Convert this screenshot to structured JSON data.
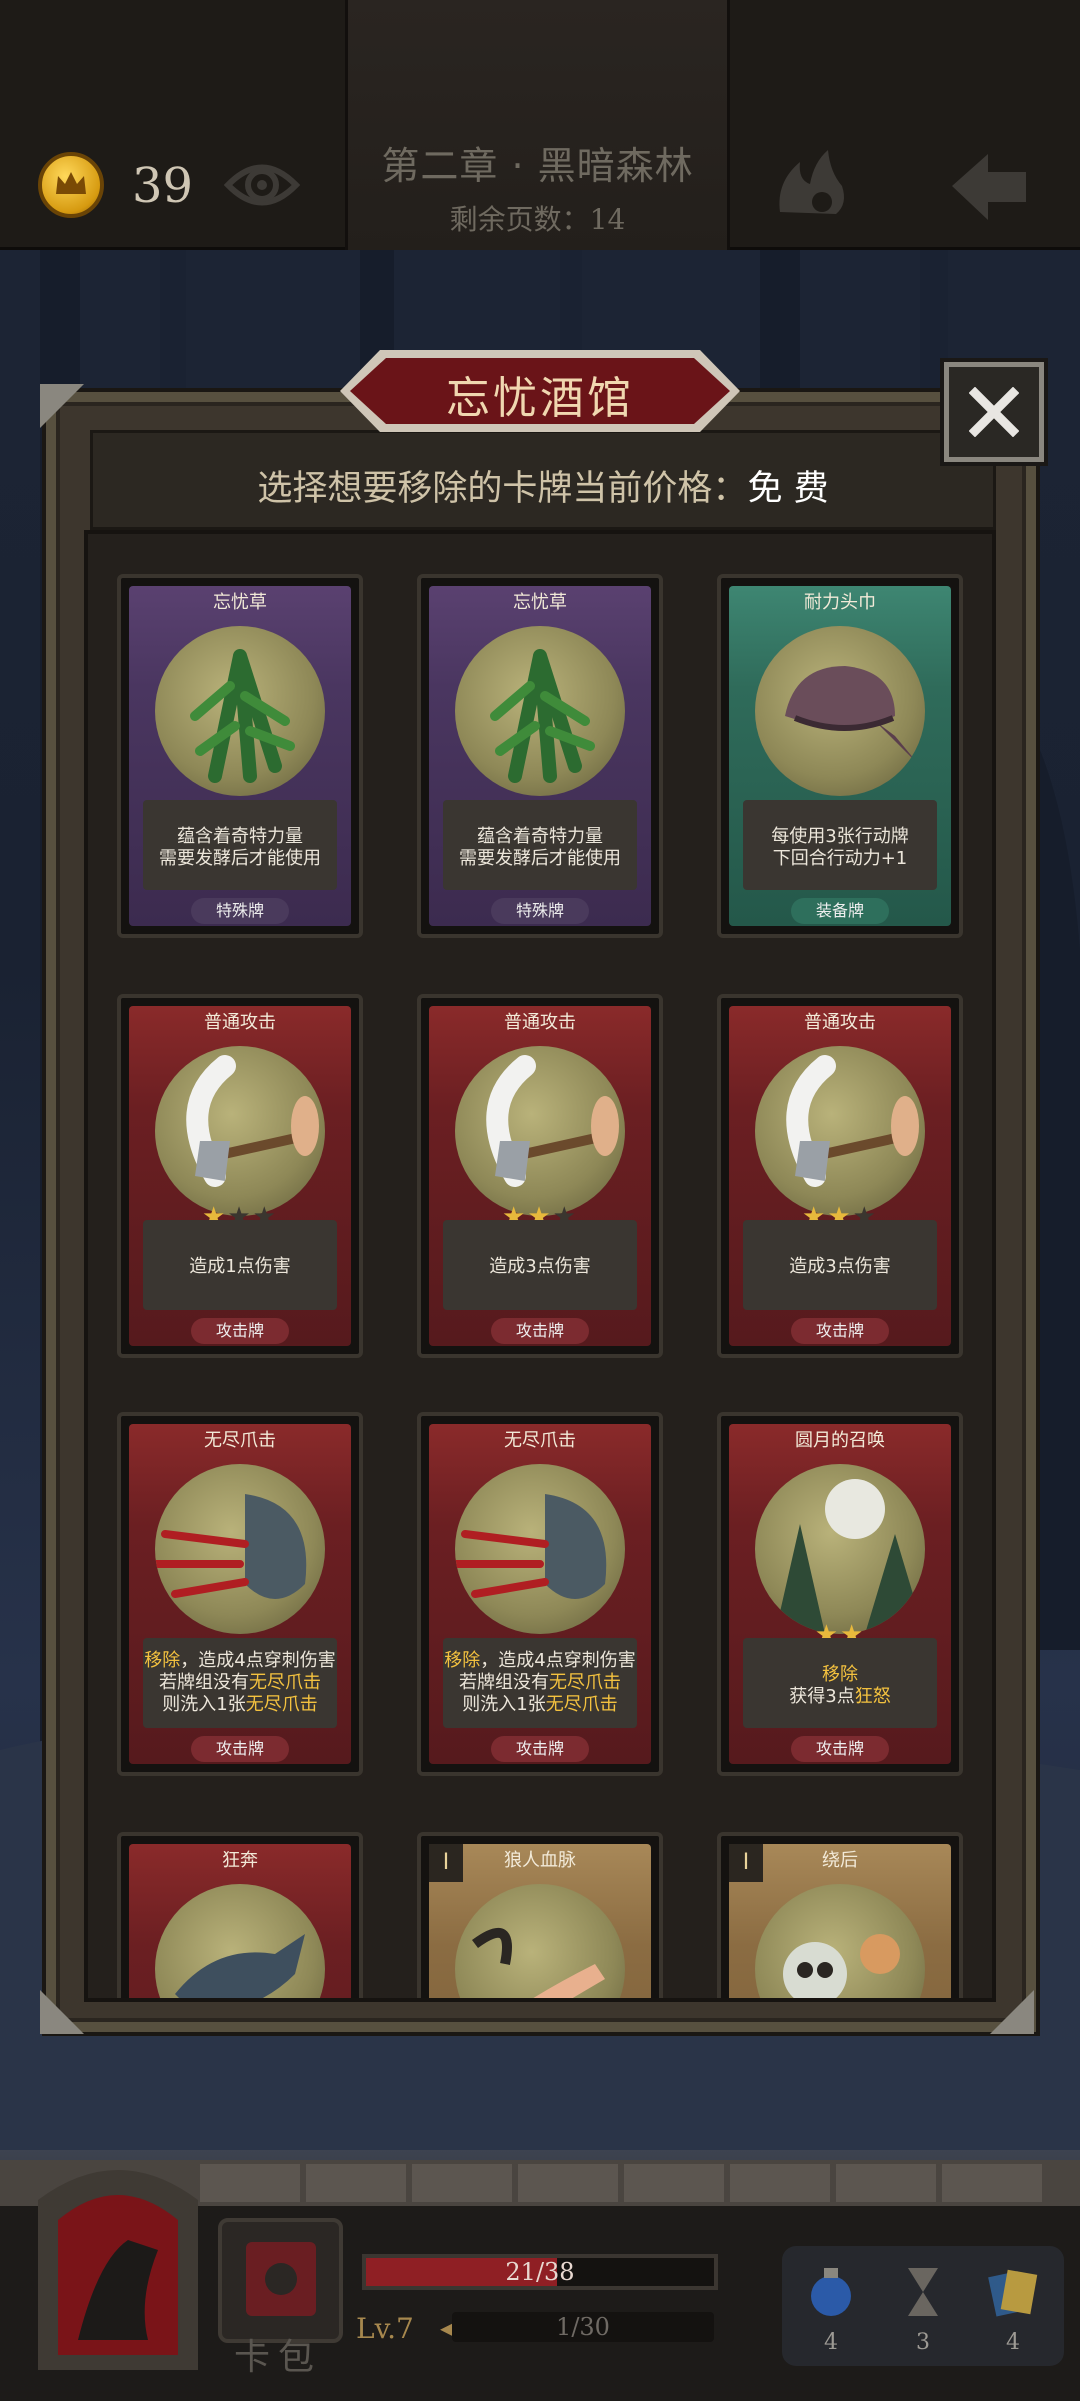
{
  "header": {
    "coins": "39",
    "chapter_title": "第二章 · 黑暗森林",
    "pages_label": "剩余页数：",
    "pages_value": "14"
  },
  "panel": {
    "title": "忘忧酒馆",
    "subtitle_prefix": "选择想要移除的卡牌当前价格：",
    "price": "免 费"
  },
  "cards": [
    {
      "name": "忘忧草",
      "desc": [
        "蕴含着奇特力量",
        "需要发酵后才能使用"
      ],
      "type": "特殊牌",
      "color": "purple"
    },
    {
      "name": "忘忧草",
      "desc": [
        "蕴含着奇特力量",
        "需要发酵后才能使用"
      ],
      "type": "特殊牌",
      "color": "purple"
    },
    {
      "name": "耐力头巾",
      "desc": [
        "每使用3张行动牌",
        "下回合行动力+1"
      ],
      "type": "装备牌",
      "color": "teal"
    },
    {
      "name": "普通攻击",
      "stars": 1,
      "desc": [
        "造成1点伤害"
      ],
      "type": "攻击牌",
      "color": "red"
    },
    {
      "name": "普通攻击",
      "stars": 2,
      "desc": [
        "造成3点伤害"
      ],
      "type": "攻击牌",
      "color": "red"
    },
    {
      "name": "普通攻击",
      "stars": 2,
      "desc": [
        "造成3点伤害"
      ],
      "type": "攻击牌",
      "color": "red"
    },
    {
      "name": "无尽爪击",
      "desc": [
        "移除，造成4点穿刺伤害",
        "若牌组没有无尽爪击",
        "则洗入1张无尽爪击"
      ],
      "type": "攻击牌",
      "color": "red"
    },
    {
      "name": "无尽爪击",
      "desc": [
        "移除，造成4点穿刺伤害",
        "若牌组没有无尽爪击",
        "则洗入1张无尽爪击"
      ],
      "type": "攻击牌",
      "color": "red"
    },
    {
      "name": "圆月的召唤",
      "stars": 2,
      "desc": [
        "移除",
        "获得3点狂怒"
      ],
      "type": "攻击牌",
      "color": "red"
    },
    {
      "name": "狂奔",
      "color": "red"
    },
    {
      "name": "狼人血脉",
      "color": "tan",
      "tag": "I"
    },
    {
      "name": "绕后",
      "color": "tan",
      "tag": "I"
    }
  ],
  "footer": {
    "bag_label": "卡包",
    "hp_text": "21/38",
    "hp_fraction": 0.55,
    "level": "Lv.7",
    "xp_text": "1/30",
    "resources": [
      "4",
      "3",
      "4"
    ]
  }
}
